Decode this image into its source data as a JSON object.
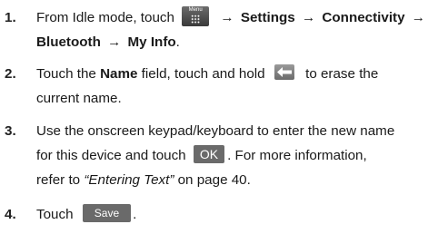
{
  "steps": [
    {
      "number": "1.",
      "line1": {
        "a": "From Idle mode, touch",
        "menu_icon_label": "Menu",
        "arrow1": "→",
        "settings": "Settings",
        "arrow2": "→",
        "connectivity": "Connectivity",
        "arrow3": "→"
      },
      "line2": {
        "bluetooth": "Bluetooth",
        "arrow4": "→",
        "my_info": "My Info",
        "end": "."
      }
    },
    {
      "number": "2.",
      "line1": {
        "a": "Touch the ",
        "name_field": "Name",
        "b": " field, touch and hold",
        "c": "to erase the"
      },
      "line2": "current name."
    },
    {
      "number": "3.",
      "line1": "Use the onscreen keypad/keyboard to enter the new name",
      "line2": {
        "a": "for this device and touch",
        "ok_label": "OK",
        "b": ". For more information,"
      },
      "line3": {
        "a": "refer to ",
        "link": "“Entering Text”",
        "b": " on page 40."
      }
    },
    {
      "number": "4.",
      "line1": {
        "a": "Touch",
        "save_label": "Save",
        "b": "."
      }
    }
  ],
  "icons": {
    "menu": "menu-grid-icon",
    "backspace": "backspace-arrow-icon"
  },
  "colors": {
    "text": "#1a1a1a",
    "button_bg": "#6a6a6a",
    "button_text": "#ffffff"
  }
}
